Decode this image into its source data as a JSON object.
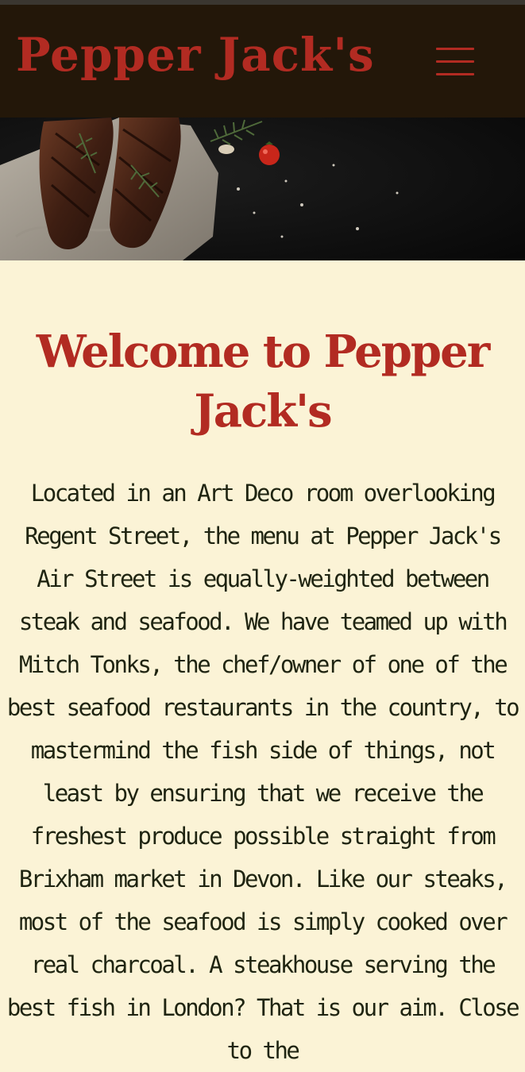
{
  "header": {
    "brand": "Pepper Jack's",
    "menu_icon": "hamburger-menu-icon",
    "brand_color": "#b22b22",
    "background": "#231709"
  },
  "hero": {
    "image": "grilled steaks with rosemary and tomato on dark slate"
  },
  "main": {
    "title": "Welcome to Pepper Jack's",
    "intro": "Located in an Art Deco room overlooking Regent Street, the menu at Pepper Jack's Air Street is equally-weighted between steak and seafood. We have teamed up with Mitch Tonks, the chef/owner of one of the best seafood restaurants in the country, to mastermind the fish side of things, not least by ensuring that we receive the freshest produce possible straight from Brixham market in Devon. Like our steaks, most of the seafood is simply cooked over real charcoal. A steakhouse serving the best fish in London? That is our aim. Close to the"
  },
  "colors": {
    "page_background": "#fbf3d6",
    "body_text": "#1f2411",
    "accent": "#b22b22"
  }
}
